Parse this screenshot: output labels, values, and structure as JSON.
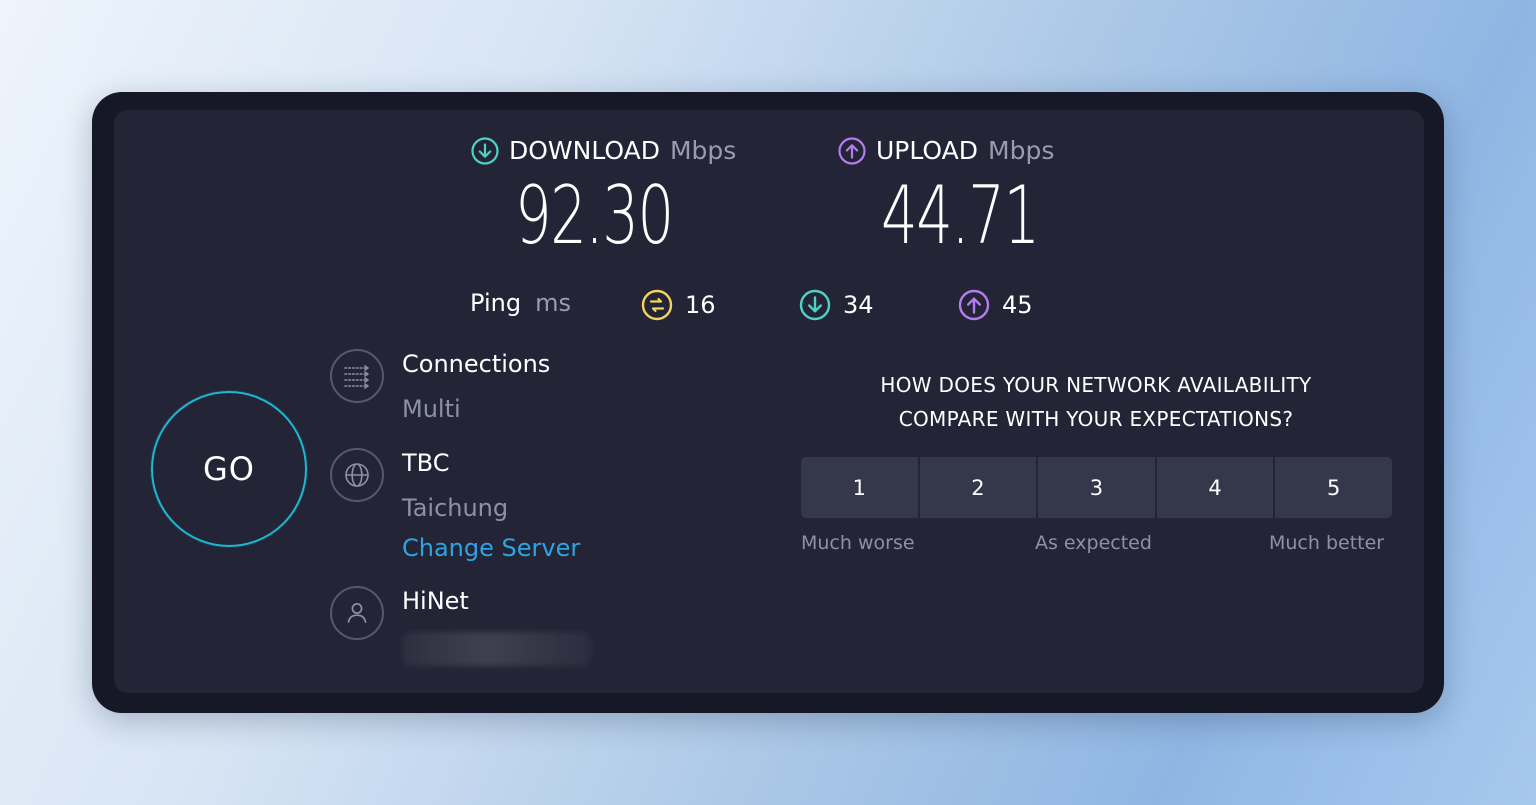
{
  "download": {
    "label": "DOWNLOAD",
    "unit": "Mbps",
    "value": "92.30",
    "icon": "arrow-down-circle-icon",
    "color": "#4fd1c5"
  },
  "upload": {
    "label": "UPLOAD",
    "unit": "Mbps",
    "value": "44.71",
    "icon": "arrow-up-circle-icon",
    "color": "#b57cf0"
  },
  "ping": {
    "label": "Ping",
    "unit": "ms",
    "idle": {
      "value": "16",
      "icon": "ping-jitter-icon",
      "color": "#f2d45c"
    },
    "download": {
      "value": "34",
      "icon": "arrow-down-circle-icon",
      "color": "#4fd1c5"
    },
    "upload": {
      "value": "45",
      "icon": "arrow-up-circle-icon",
      "color": "#b57cf0"
    }
  },
  "go_button": {
    "label": "GO",
    "color": "#1fb6d1"
  },
  "connections": {
    "title": "Connections",
    "value": "Multi",
    "icon": "connections-icon"
  },
  "server": {
    "title": "TBC",
    "location": "Taichung",
    "change_label": "Change Server",
    "icon": "globe-icon",
    "link_color": "#2ea3e2"
  },
  "provider": {
    "title": "HiNet",
    "icon": "user-icon"
  },
  "survey": {
    "question_line1": "HOW DOES YOUR NETWORK AVAILABILITY",
    "question_line2": "COMPARE WITH YOUR EXPECTATIONS?",
    "ratings": [
      "1",
      "2",
      "3",
      "4",
      "5"
    ],
    "low_label": "Much worse",
    "mid_label": "As expected",
    "high_label": "Much better"
  }
}
